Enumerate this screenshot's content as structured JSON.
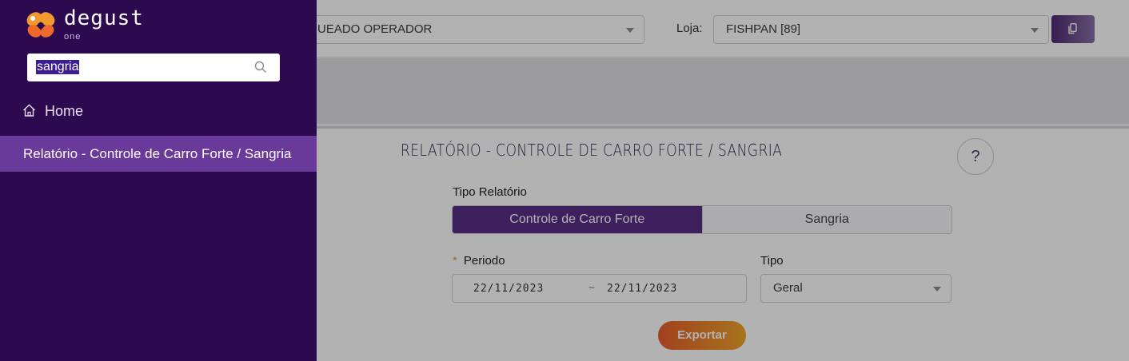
{
  "header": {
    "operator_select_value": "UEADO OPERADOR",
    "loja_label": "Loja:",
    "loja_value": "FISHPAN [89]"
  },
  "sidebar": {
    "logo_text": "degust",
    "logo_sub": "one",
    "search_value": "sangria",
    "items": [
      {
        "label": "Home",
        "icon": "home-icon"
      },
      {
        "label": "Relatório - Controle de Carro Forte / Sangria",
        "active": true
      }
    ]
  },
  "page": {
    "title": "RELATÓRIO - CONTROLE DE CARRO FORTE / SANGRIA",
    "help_label": "?",
    "tipo_relatorio_label": "Tipo Relatório",
    "tipo_relatorio_options": [
      "Controle de Carro Forte",
      "Sangria"
    ],
    "periodo_label": "Periodo",
    "periodo_required": "*",
    "date_start": "22/11/2023",
    "date_separator": "~",
    "date_end": "22/11/2023",
    "tipo_label": "Tipo",
    "tipo_value": "Geral",
    "export_label": "Exportar"
  },
  "colors": {
    "sidebar_bg": "#2d0a4f",
    "accent_purple": "#5b2e87",
    "active_menu": "#6a3a9a",
    "export_gradient_start": "#e85d2c",
    "export_gradient_end": "#f0a62a"
  }
}
